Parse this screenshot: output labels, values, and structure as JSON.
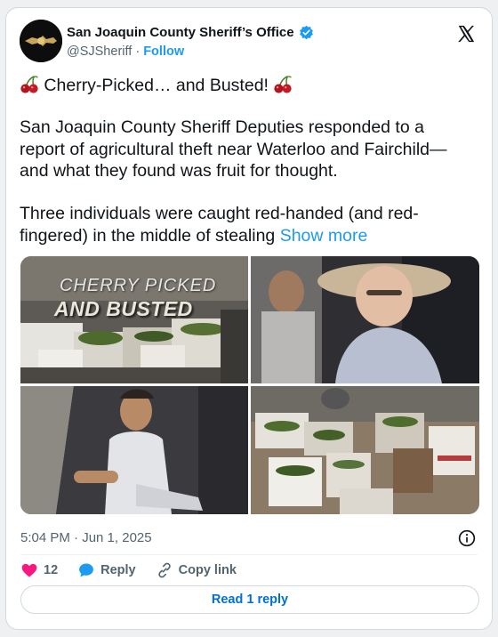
{
  "author": {
    "name": "San Joaquin County Sheriff’s Office",
    "handle": "@SJSheriff",
    "separator": "·",
    "follow_label": "Follow",
    "verified": true
  },
  "tweet": {
    "title_text": "Cherry-Picked… and Busted!",
    "para1": "San Joaquin County Sheriff Deputies responded to a report of agricultural theft near Waterloo and Fairchild—and what they found was fruit for thought.",
    "para2": "Three individuals were caught red-handed (and red-fingered) in the middle of stealing",
    "show_more": "Show more"
  },
  "media": {
    "overlay_line1": "CHERRY PICKED",
    "overlay_line2": "AND BUSTED"
  },
  "meta": {
    "timestamp": "5:04 PM · Jun 1, 2025"
  },
  "actions": {
    "like_count": "12",
    "reply_label": "Reply",
    "copy_link_label": "Copy link"
  },
  "read_replies_label": "Read 1 reply",
  "colors": {
    "accent": "#1d9bf0",
    "link_button": "#006fd6",
    "like": "#f91880",
    "muted": "#536471"
  },
  "icons": [
    "x-logo-icon",
    "verified-badge-icon",
    "cherry-icon",
    "info-icon",
    "heart-icon",
    "reply-bubble-icon",
    "link-icon"
  ]
}
